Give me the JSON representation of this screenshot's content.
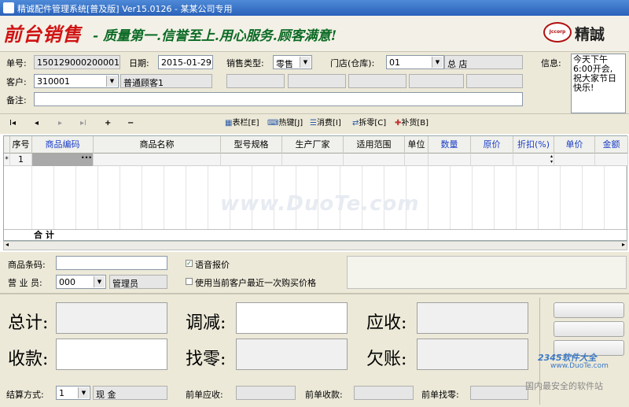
{
  "title": "精诚配件管理系统[普及版] Ver15.0126  -  某某公司专用",
  "banner": {
    "title": "前台销售",
    "slogan": "- 质量第一.信誉至上.用心服务.顾客满意!",
    "logo_text": "Jccorp",
    "brand": "精誠"
  },
  "form": {
    "order_no_label": "单号:",
    "order_no": "150129000200001",
    "date_label": "日期:",
    "date": "2015-01-29",
    "sale_type_label": "销售类型:",
    "sale_type": "零售",
    "store_label": "门店(仓库):",
    "store_code": "01",
    "store_name": "总  店",
    "info_label": "信息:",
    "info_text": "今天下午6:00开会, 祝大家节日快乐!",
    "customer_label": "客户:",
    "customer_code": "310001",
    "customer_name": "普通顾客1",
    "remark_label": "备注:"
  },
  "toolbar": {
    "nav": [
      "I◂",
      "◂",
      "▸",
      "▸I",
      "+",
      "−"
    ],
    "actions": [
      "表栏[E]",
      "热键[J]",
      "消费[I]",
      "拆零[C]",
      "补货[B]"
    ]
  },
  "grid": {
    "columns": [
      "序号",
      "商品编码",
      "商品名称",
      "型号规格",
      "生产厂家",
      "适用范围",
      "单位",
      "数量",
      "原价",
      "折扣(%)",
      "单价",
      "金额"
    ],
    "row_marker": "*",
    "row_no": "1",
    "total_label": "合   计"
  },
  "mid": {
    "barcode_label": "商品条码:",
    "clerk_label": "营 业 员:",
    "clerk_code": "000",
    "clerk_name": "管理员",
    "voice_label": "语音报价",
    "last_price_label": "使用当前客户最近一次购买价格"
  },
  "bottom": {
    "total_label": "总计:",
    "adjust_label": "调减:",
    "receivable_label": "应收:",
    "received_label": "收款:",
    "change_label": "找零:",
    "owed_label": "欠账:",
    "pay_method_label": "结算方式:",
    "pay_method_code": "1",
    "pay_method_name": "现  金",
    "prev_receivable_label": "前单应收:",
    "prev_received_label": "前单收款:",
    "prev_change_label": "前单找零:"
  },
  "watermarks": {
    "center": "www.DuoTe.com",
    "corner1": "2345软件大全",
    "corner2": "www.DuoTe.com",
    "corner3": "国内最安全的软件站"
  },
  "colors": {
    "title_bg": "#2a62b9",
    "banner_red": "#d01414",
    "slogan_green": "#0b6a24",
    "panel": "#ece9d8"
  }
}
